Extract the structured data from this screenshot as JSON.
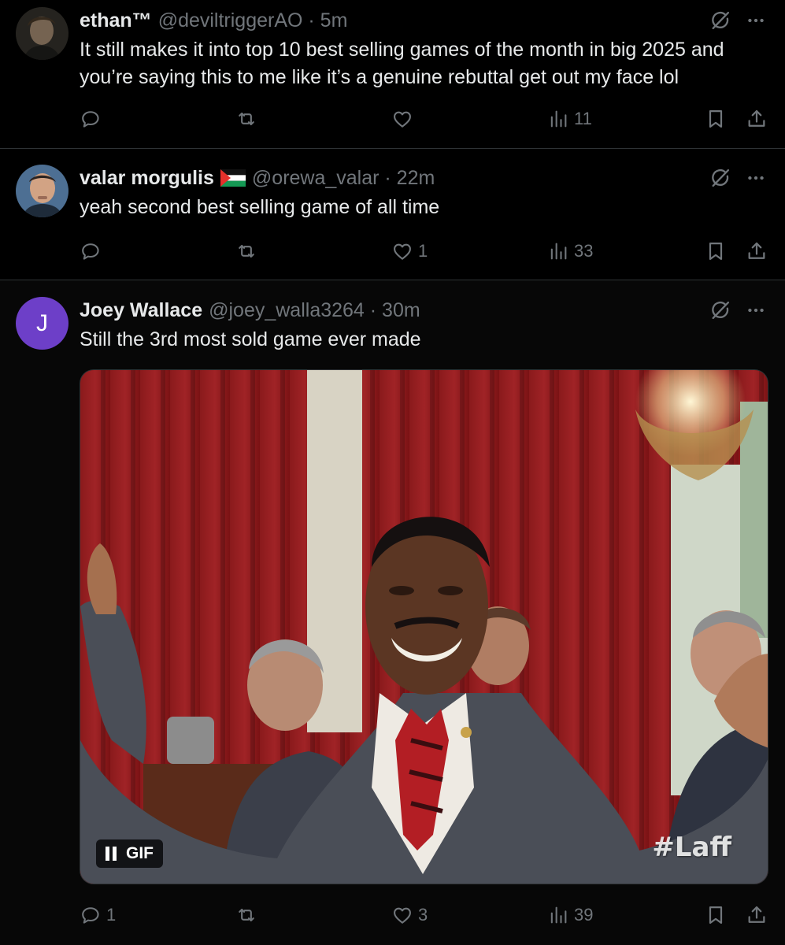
{
  "tweets": [
    {
      "name": "ethan™",
      "meta": "@deviltriggerAO · 5m",
      "text": "It still makes it into top 10 best selling games of the month in big 2025 and you’re saying this to me like it’s a genuine rebuttal get out my face lol",
      "replies": "",
      "retweets": "",
      "likes": "",
      "views": "11"
    },
    {
      "name": "valar morgulis",
      "meta": "@orewa_valar · 22m",
      "text": "yeah second best selling game of all time",
      "replies": "",
      "retweets": "",
      "likes": "1",
      "views": "33"
    },
    {
      "name": "Joey Wallace",
      "meta": "@joey_walla3264 · 30m",
      "avatar_letter": "J",
      "text": "Still the 3rd most sold game ever made",
      "media": {
        "badge_label": "GIF",
        "watermark": "#Laff"
      },
      "replies": "1",
      "retweets": "",
      "likes": "3",
      "views": "39"
    }
  ],
  "colors": {
    "background": "#000000",
    "text_primary": "#e7e9ea",
    "text_secondary": "#71767b",
    "divider": "#2f3336",
    "avatar_j": "#6d3fc8"
  },
  "icons": [
    "grok-icon",
    "more-icon",
    "reply-icon",
    "retweet-icon",
    "like-icon",
    "views-icon",
    "bookmark-icon",
    "share-icon",
    "pause-icon"
  ]
}
